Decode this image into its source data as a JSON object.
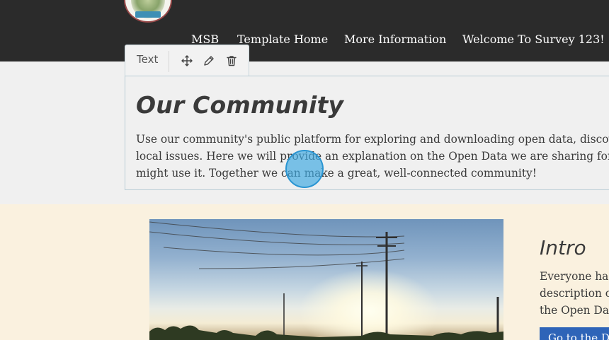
{
  "header": {
    "nav": [
      "MSB",
      "Template Home",
      "More Information",
      "Welcome To Survey 123!"
    ]
  },
  "toolbar": {
    "label": "Text",
    "icons": [
      "move-icon",
      "pencil-icon",
      "trash-icon"
    ]
  },
  "text_widget": {
    "title": "Our Community",
    "lines": [
      "Use our community's public platform for exploring and downloading open data, discove",
      "local issues. Here we will provide an explanation on the Open Data we are sharing for o",
      "might use it. Together we can make a great, well-connected community!"
    ]
  },
  "intro": {
    "title": "Intro",
    "lines": [
      "Everyone has",
      "description o",
      "the Open Dat"
    ],
    "button": "Go to the D"
  },
  "colors": {
    "header_bg": "#2b2b2b",
    "page_bg": "#f0f0f0",
    "lower_bg": "#faf1df",
    "accent": "#2e64b8",
    "widget_border": "#b9cdd6"
  }
}
